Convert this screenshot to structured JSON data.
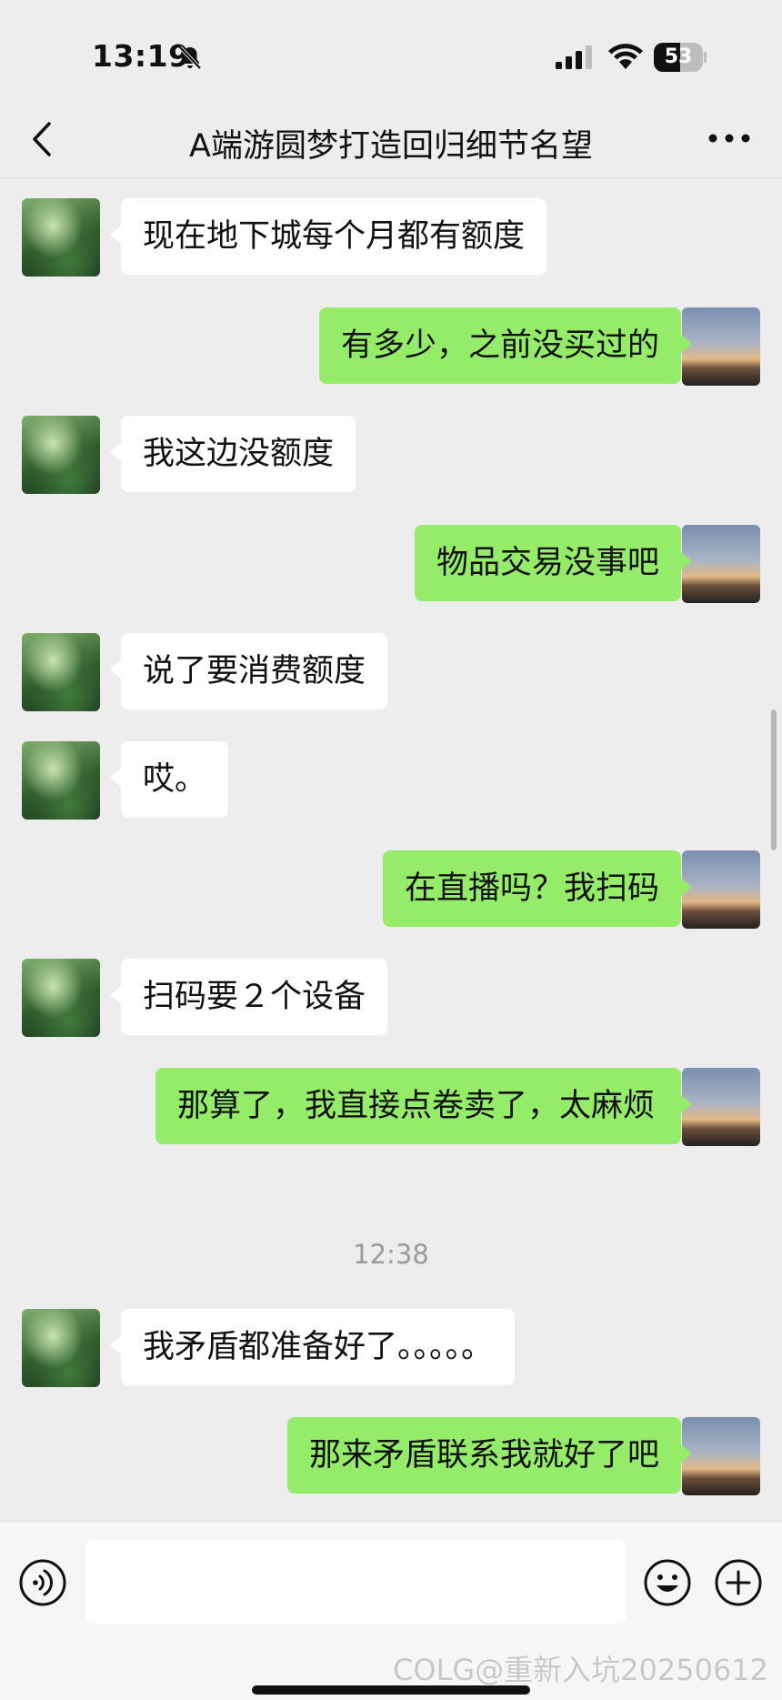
{
  "status_bar": {
    "time": "13:19",
    "battery_level": "53",
    "icons": [
      "bell-muted-icon",
      "cellular-signal-icon",
      "wifi-icon",
      "battery-icon"
    ]
  },
  "header": {
    "title": "A端游圆梦打造回归细节名望",
    "back_icon": "chevron-left-icon",
    "more_icon": "more-dots-icon"
  },
  "messages": [
    {
      "sender": "other",
      "text": "现在地下城每个月都有额度"
    },
    {
      "sender": "me",
      "text": "有多少，之前没买过的"
    },
    {
      "sender": "other",
      "text": "我这边没额度"
    },
    {
      "sender": "me",
      "text": "物品交易没事吧"
    },
    {
      "sender": "other",
      "text": "说了要消费额度"
    },
    {
      "sender": "other",
      "text": "哎。"
    },
    {
      "sender": "me",
      "text": "在直播吗？我扫码"
    },
    {
      "sender": "other",
      "text": "扫码要２个设备"
    },
    {
      "sender": "me",
      "text": "那算了，我直接点卷卖了，太麻烦"
    },
    {
      "timestamp": "12:38"
    },
    {
      "sender": "other",
      "text": "我矛盾都准备好了。。。。。"
    },
    {
      "sender": "me",
      "text": "那来矛盾联系我就好了吧"
    }
  ],
  "input_bar": {
    "value": "",
    "placeholder": "",
    "voice_icon": "voice-icon",
    "emoji_icon": "emoji-icon",
    "plus_icon": "plus-icon"
  },
  "watermark": "COLG@重新入坑20250612",
  "colors": {
    "background": "#ededed",
    "my_bubble": "#95ec69",
    "other_bubble": "#ffffff",
    "timestamp": "#9a9a9a"
  }
}
